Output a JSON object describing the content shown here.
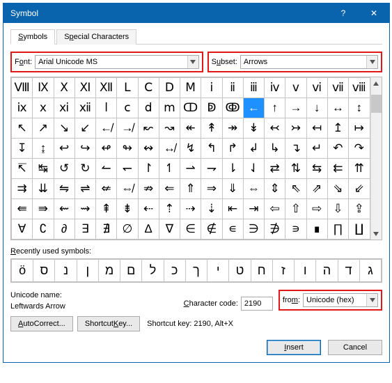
{
  "window": {
    "title": "Symbol"
  },
  "tabs": {
    "symbols": "Symbols",
    "special": "Special Characters"
  },
  "font": {
    "label_pre": "F",
    "label_ul": "o",
    "label_post": "nt:",
    "value": "Arial Unicode MS"
  },
  "subset": {
    "label_pre": "S",
    "label_ul": "u",
    "label_post": "bset:",
    "value": "Arrows"
  },
  "grid": {
    "rows": [
      [
        "Ⅷ",
        "Ⅸ",
        "Ⅹ",
        "Ⅺ",
        "Ⅻ",
        "Ⅼ",
        "Ⅽ",
        "Ⅾ",
        "Ⅿ",
        "ⅰ",
        "ⅱ",
        "ⅲ",
        "ⅳ",
        "ⅴ",
        "ⅵ",
        "ⅶ",
        "ⅷ"
      ],
      [
        "ⅸ",
        "ⅹ",
        "ⅺ",
        "ⅻ",
        "ⅼ",
        "ⅽ",
        "ⅾ",
        "ⅿ",
        "ↀ",
        "ↁ",
        "ↂ",
        "←",
        "↑",
        "→",
        "↓",
        "↔",
        "↕"
      ],
      [
        "↖",
        "↗",
        "↘",
        "↙",
        "↚",
        "↛",
        "↜",
        "↝",
        "↞",
        "↟",
        "↠",
        "↡",
        "↢",
        "↣",
        "↤",
        "↥",
        "↦"
      ],
      [
        "↧",
        "↨",
        "↩",
        "↪",
        "↫",
        "↬",
        "↭",
        "↮",
        "↯",
        "↰",
        "↱",
        "↲",
        "↳",
        "↴",
        "↵",
        "↶",
        "↷"
      ],
      [
        "↸",
        "↹",
        "↺",
        "↻",
        "↼",
        "↽",
        "↾",
        "↿",
        "⇀",
        "⇁",
        "⇂",
        "⇃",
        "⇄",
        "⇅",
        "⇆",
        "⇇",
        "⇈"
      ],
      [
        "⇉",
        "⇊",
        "⇋",
        "⇌",
        "⇍",
        "⇎",
        "⇏",
        "⇐",
        "⇑",
        "⇒",
        "⇓",
        "⇔",
        "⇕",
        "⇖",
        "⇗",
        "⇘",
        "⇙"
      ],
      [
        "⇚",
        "⇛",
        "⇜",
        "⇝",
        "⇞",
        "⇟",
        "⇠",
        "⇡",
        "⇢",
        "⇣",
        "⇤",
        "⇥",
        "⇦",
        "⇧",
        "⇨",
        "⇩",
        "⇪"
      ],
      [
        "∀",
        "∁",
        "∂",
        "∃",
        "∄",
        "∅",
        "∆",
        "∇",
        "∈",
        "∉",
        "∊",
        "∋",
        "∌",
        "∍",
        "∎",
        "∏",
        "∐"
      ]
    ],
    "selected": {
      "row": 1,
      "col": 11
    }
  },
  "recent": {
    "label_pre": "",
    "label_ul": "R",
    "label_post": "ecently used symbols:",
    "items": [
      "ö",
      "ס",
      "נ",
      "ן",
      "מ",
      "ם",
      "ל",
      "כ",
      "ך",
      "י",
      "ט",
      "ח",
      "ז",
      "ו",
      "ה",
      "ד",
      "ג"
    ]
  },
  "unicode": {
    "name_label": "Unicode name:",
    "name_value": "Leftwards Arrow",
    "code_label_ul": "C",
    "code_label_post": "haracter code:",
    "code_value": "2190",
    "from_label_pre": "fro",
    "from_label_ul": "m",
    "from_label_post": ":",
    "from_value": "Unicode (hex)"
  },
  "buttons": {
    "autocorrect_ul": "A",
    "autocorrect_post": "utoCorrect...",
    "shortcut_pre": "Shortcut ",
    "shortcut_ul": "K",
    "shortcut_post": "ey...",
    "shortcut_info": "Shortcut key: 2190, Alt+X",
    "insert_ul": "I",
    "insert_post": "nsert",
    "cancel": "Cancel"
  }
}
